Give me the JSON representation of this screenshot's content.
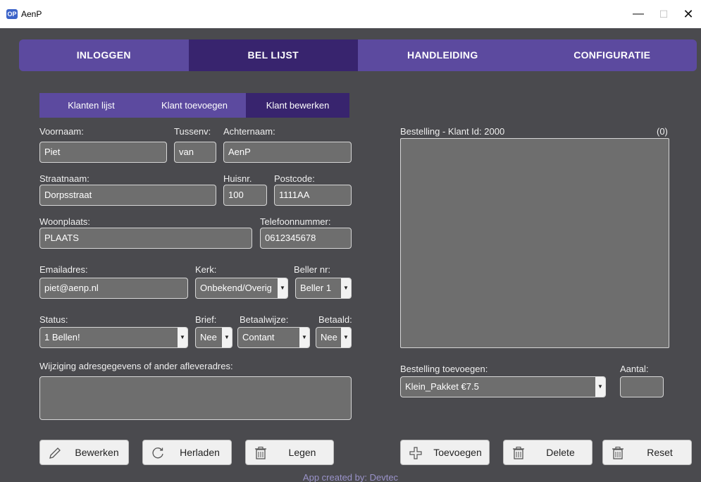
{
  "window": {
    "title": "AenP",
    "logo_text": "OP",
    "minimize": "—",
    "maximize": "☐",
    "close": "✕"
  },
  "nav": {
    "tabs": [
      "INLOGGEN",
      "BEL LIJST",
      "HANDLEIDING",
      "CONFIGURATIE"
    ],
    "active": "BEL LIJST"
  },
  "subtabs": {
    "items": [
      "Klanten lijst",
      "Klant toevoegen",
      "Klant bewerken"
    ],
    "active": "Klant bewerken"
  },
  "form": {
    "voornaam_label": "Voornaam:",
    "voornaam": "Piet",
    "tussenv_label": "Tussenv:",
    "tussenv": "van",
    "achternaam_label": "Achternaam:",
    "achternaam": "AenP",
    "straatnaam_label": "Straatnaam:",
    "straatnaam": "Dorpsstraat",
    "huisnr_label": "Huisnr.",
    "huisnr": "100",
    "postcode_label": "Postcode:",
    "postcode": "1111AA",
    "woonplaats_label": "Woonplaats:",
    "woonplaats": "PLAATS",
    "telefoon_label": "Telefoonnummer:",
    "telefoon": "0612345678",
    "email_label": "Emailadres:",
    "email": "piet@aenp.nl",
    "kerk_label": "Kerk:",
    "kerk": "Onbekend/Overig",
    "beller_label": "Beller nr:",
    "beller": "Beller 1",
    "status_label": "Status:",
    "status": "1 Bellen!",
    "brief_label": "Brief:",
    "brief": "Nee",
    "betaalwijze_label": "Betaalwijze:",
    "betaalwijze": "Contant",
    "betaald_label": "Betaald:",
    "betaald": "Nee",
    "wijziging_label": "Wijziging adresgegevens of ander afleveradres:"
  },
  "order": {
    "header_label": "Bestelling - Klant Id:",
    "klant_id": "2000",
    "count": "(0)",
    "add_label": "Bestelling toevoegen:",
    "product": "Klein_Pakket €7.5",
    "aantal_label": "Aantal:"
  },
  "buttons": {
    "bewerken": "Bewerken",
    "herladen": "Herladen",
    "legen": "Legen",
    "toevoegen": "Toevoegen",
    "delete": "Delete",
    "reset": "Reset"
  },
  "footer": "App created by: Devtec"
}
